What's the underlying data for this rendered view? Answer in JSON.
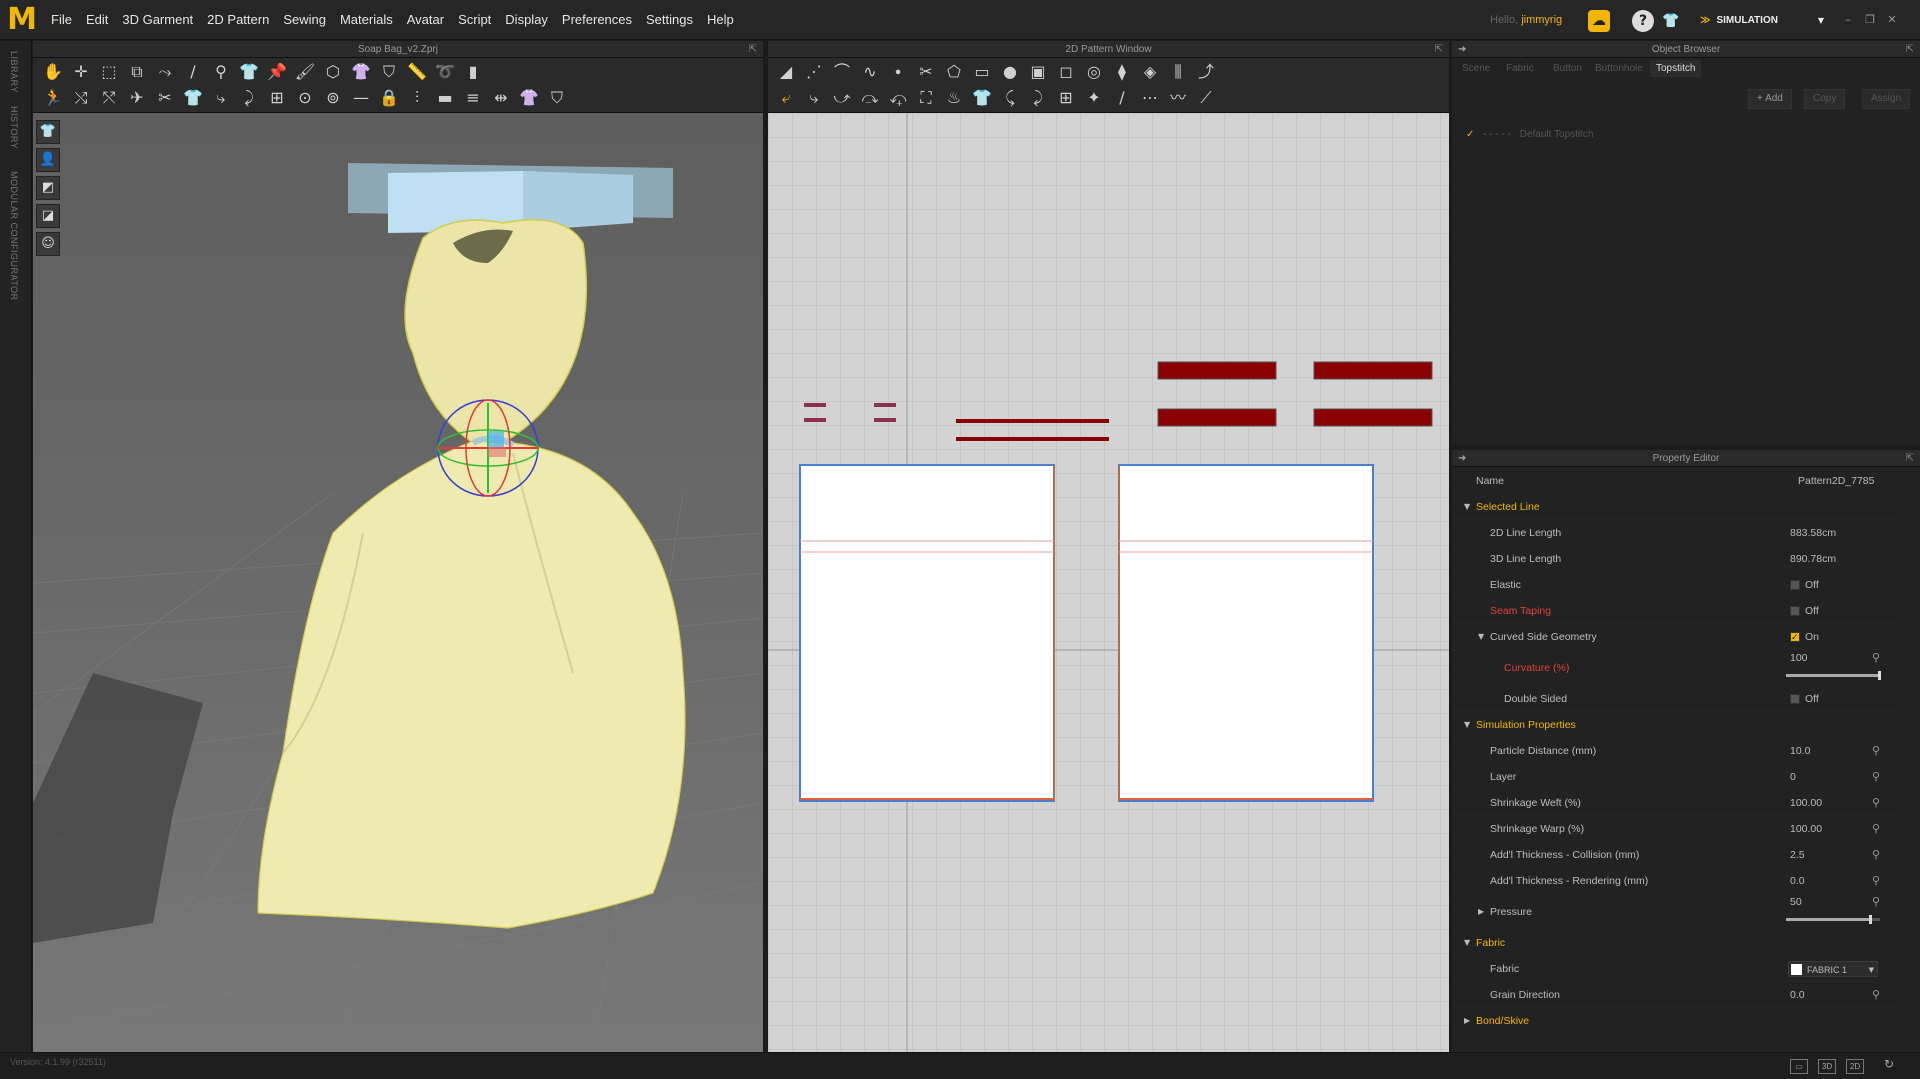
{
  "menubar": {
    "logo": "M",
    "items": [
      "File",
      "Edit",
      "3D Garment",
      "2D Pattern",
      "Sewing",
      "Materials",
      "Avatar",
      "Script",
      "Display",
      "Preferences",
      "Settings",
      "Help"
    ],
    "hello_prefix": "Hello,",
    "username": "jimmyrig",
    "mode_label": "SIMULATION"
  },
  "left_strip": {
    "labels": [
      "LIBRARY",
      "HISTORY",
      "MODULAR CONFIGURATOR"
    ]
  },
  "view3d": {
    "title": "Soap Bag_v2.Zprj"
  },
  "view2d": {
    "title": "2D Pattern Window"
  },
  "object_browser": {
    "title": "Object Browser",
    "tabs": [
      "Scene",
      "Fabric",
      "Button",
      "Buttonhole",
      "Topstitch"
    ],
    "active_tab": "Topstitch",
    "buttons": {
      "add": "+ Add",
      "copy": "Copy",
      "assign": "Assign"
    },
    "items": [
      {
        "label": "Default Topstitch",
        "checked": true
      }
    ]
  },
  "property_editor": {
    "title": "Property Editor",
    "name_label": "Name",
    "name_value": "Pattern2D_7785",
    "sections": {
      "selected_line": "Selected Line",
      "simulation": "Simulation Properties",
      "fabric": "Fabric",
      "bond": "Bond/Skive"
    },
    "rows": {
      "line2d": {
        "label": "2D Line Length",
        "value": "883.58cm"
      },
      "line3d": {
        "label": "3D Line Length",
        "value": "890.78cm"
      },
      "elastic": {
        "label": "Elastic",
        "value": "Off"
      },
      "seam_taping": {
        "label": "Seam Taping",
        "value": "Off"
      },
      "curved": {
        "label": "Curved Side Geometry",
        "value": "On"
      },
      "curvature": {
        "label": "Curvature (%)",
        "value": "100",
        "level": 1.0
      },
      "double_sided": {
        "label": "Double Sided",
        "value": "Off"
      },
      "particle": {
        "label": "Particle Distance (mm)",
        "value": "10.0"
      },
      "layer": {
        "label": "Layer",
        "value": "0"
      },
      "weft": {
        "label": "Shrinkage Weft (%)",
        "value": "100.00"
      },
      "warp": {
        "label": "Shrinkage Warp (%)",
        "value": "100.00"
      },
      "collision": {
        "label": "Add'l Thickness - Collision (mm)",
        "value": "2.5"
      },
      "rendering": {
        "label": "Add'l Thickness - Rendering (mm)",
        "value": "0.0"
      },
      "pressure": {
        "label": "Pressure",
        "value": "50",
        "level": 0.9
      },
      "fabric": {
        "label": "Fabric",
        "value": "FABRIC 1"
      },
      "grain": {
        "label": "Grain Direction",
        "value": "0.0"
      }
    }
  },
  "status": {
    "version": "Version: 4.1.99 (r32511)",
    "views": [
      "3D",
      "2D"
    ]
  },
  "colors": {
    "accent": "#f2b705",
    "fabric": "#efeab0",
    "strap": "#8b0000",
    "select_blue": "#4a7fd6"
  }
}
